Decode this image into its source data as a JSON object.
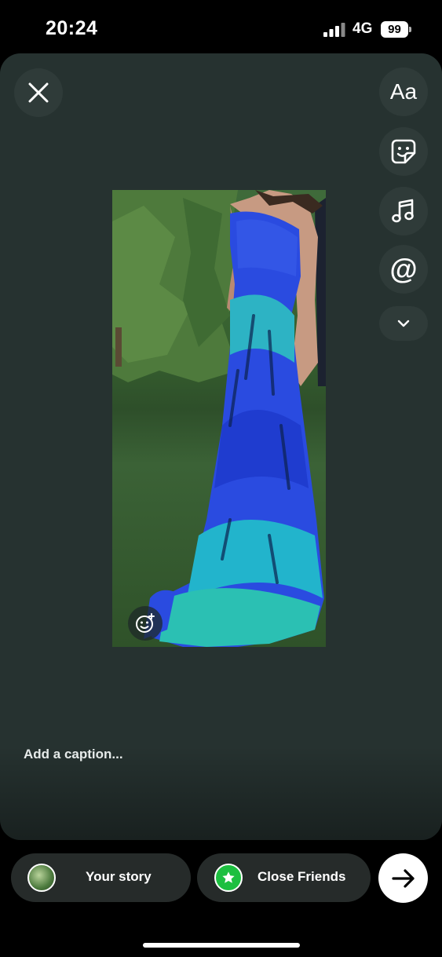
{
  "status_bar": {
    "time": "20:24",
    "network": "4G",
    "battery": "99"
  },
  "editor": {
    "tools": {
      "text_tool": "Aa",
      "mention_tool": "@"
    },
    "icons": [
      "close-icon",
      "sticker-icon",
      "music-icon",
      "chevron-down-icon",
      "emoji-add-icon"
    ],
    "caption_placeholder": "Add a caption..."
  },
  "share": {
    "your_story_label": "Your story",
    "close_friends_label": "Close Friends",
    "next_icon": "arrow-right-icon"
  },
  "colors": {
    "editor_bg": "#263230",
    "close_friends_green": "#1dbf40",
    "pill_bg": "#262b2a"
  }
}
